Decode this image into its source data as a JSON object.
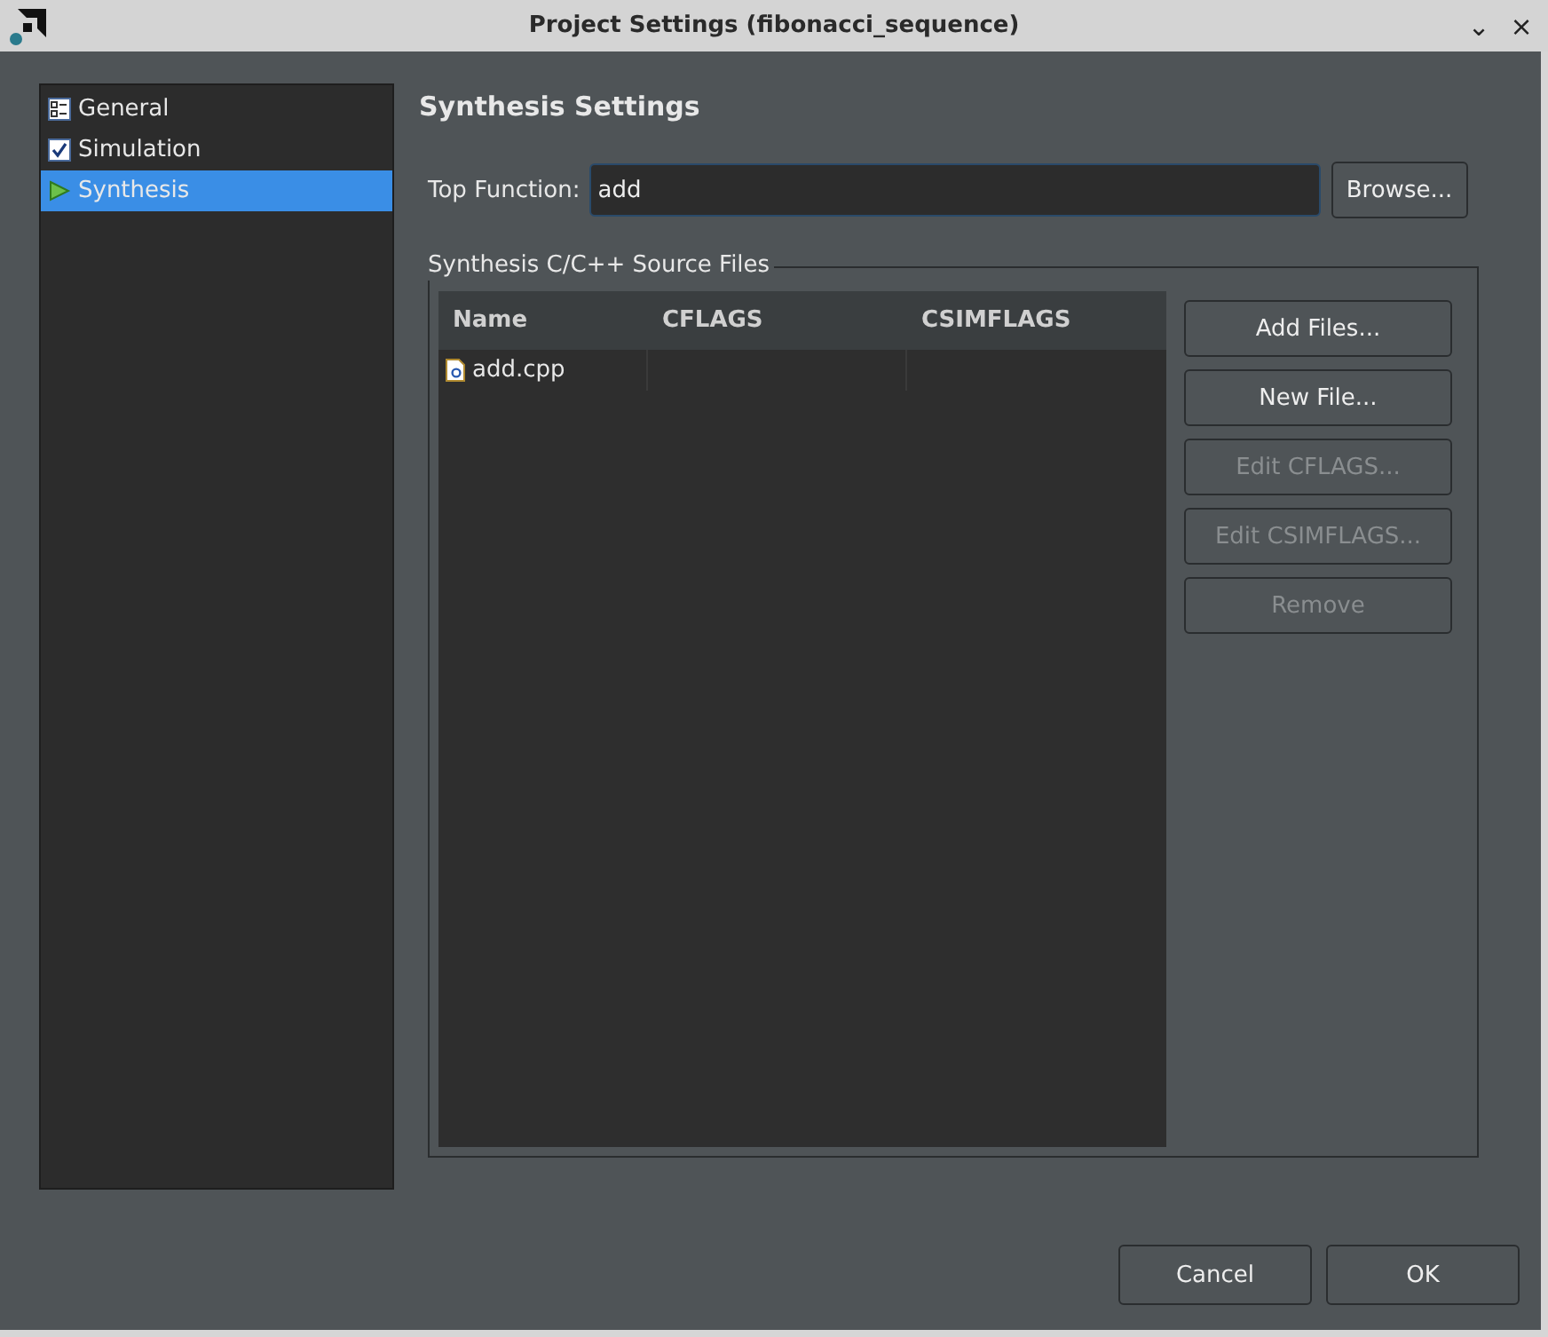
{
  "window": {
    "title": "Project Settings (fibonacci_sequence)",
    "controls": [
      "⌄",
      "×"
    ]
  },
  "sidebar": {
    "items": [
      {
        "label": "General",
        "kind": "form",
        "selected": false
      },
      {
        "label": "Simulation",
        "kind": "check",
        "selected": false
      },
      {
        "label": "Synthesis",
        "kind": "play",
        "selected": true
      }
    ]
  },
  "heading": "Synthesis Settings",
  "top_function": {
    "label": "Top Function:",
    "value": "add",
    "button": "Browse..."
  },
  "source_files": {
    "title": "Synthesis C/C++ Source Files",
    "table": {
      "columns": [
        "Name",
        "CFLAGS",
        "CSIMFLAGS"
      ],
      "rows": [
        [
          "add.cpp",
          "",
          ""
        ]
      ]
    },
    "buttons": [
      {
        "label": "Add Files...",
        "disabled": false
      },
      {
        "label": "New File...",
        "disabled": false
      },
      {
        "label": "Edit CFLAGS...",
        "disabled": true
      },
      {
        "label": "Edit CSIMFLAGS...",
        "disabled": true
      },
      {
        "label": "Remove",
        "disabled": true
      }
    ]
  },
  "footer": {
    "buttons": [
      "Cancel",
      "OK"
    ]
  }
}
